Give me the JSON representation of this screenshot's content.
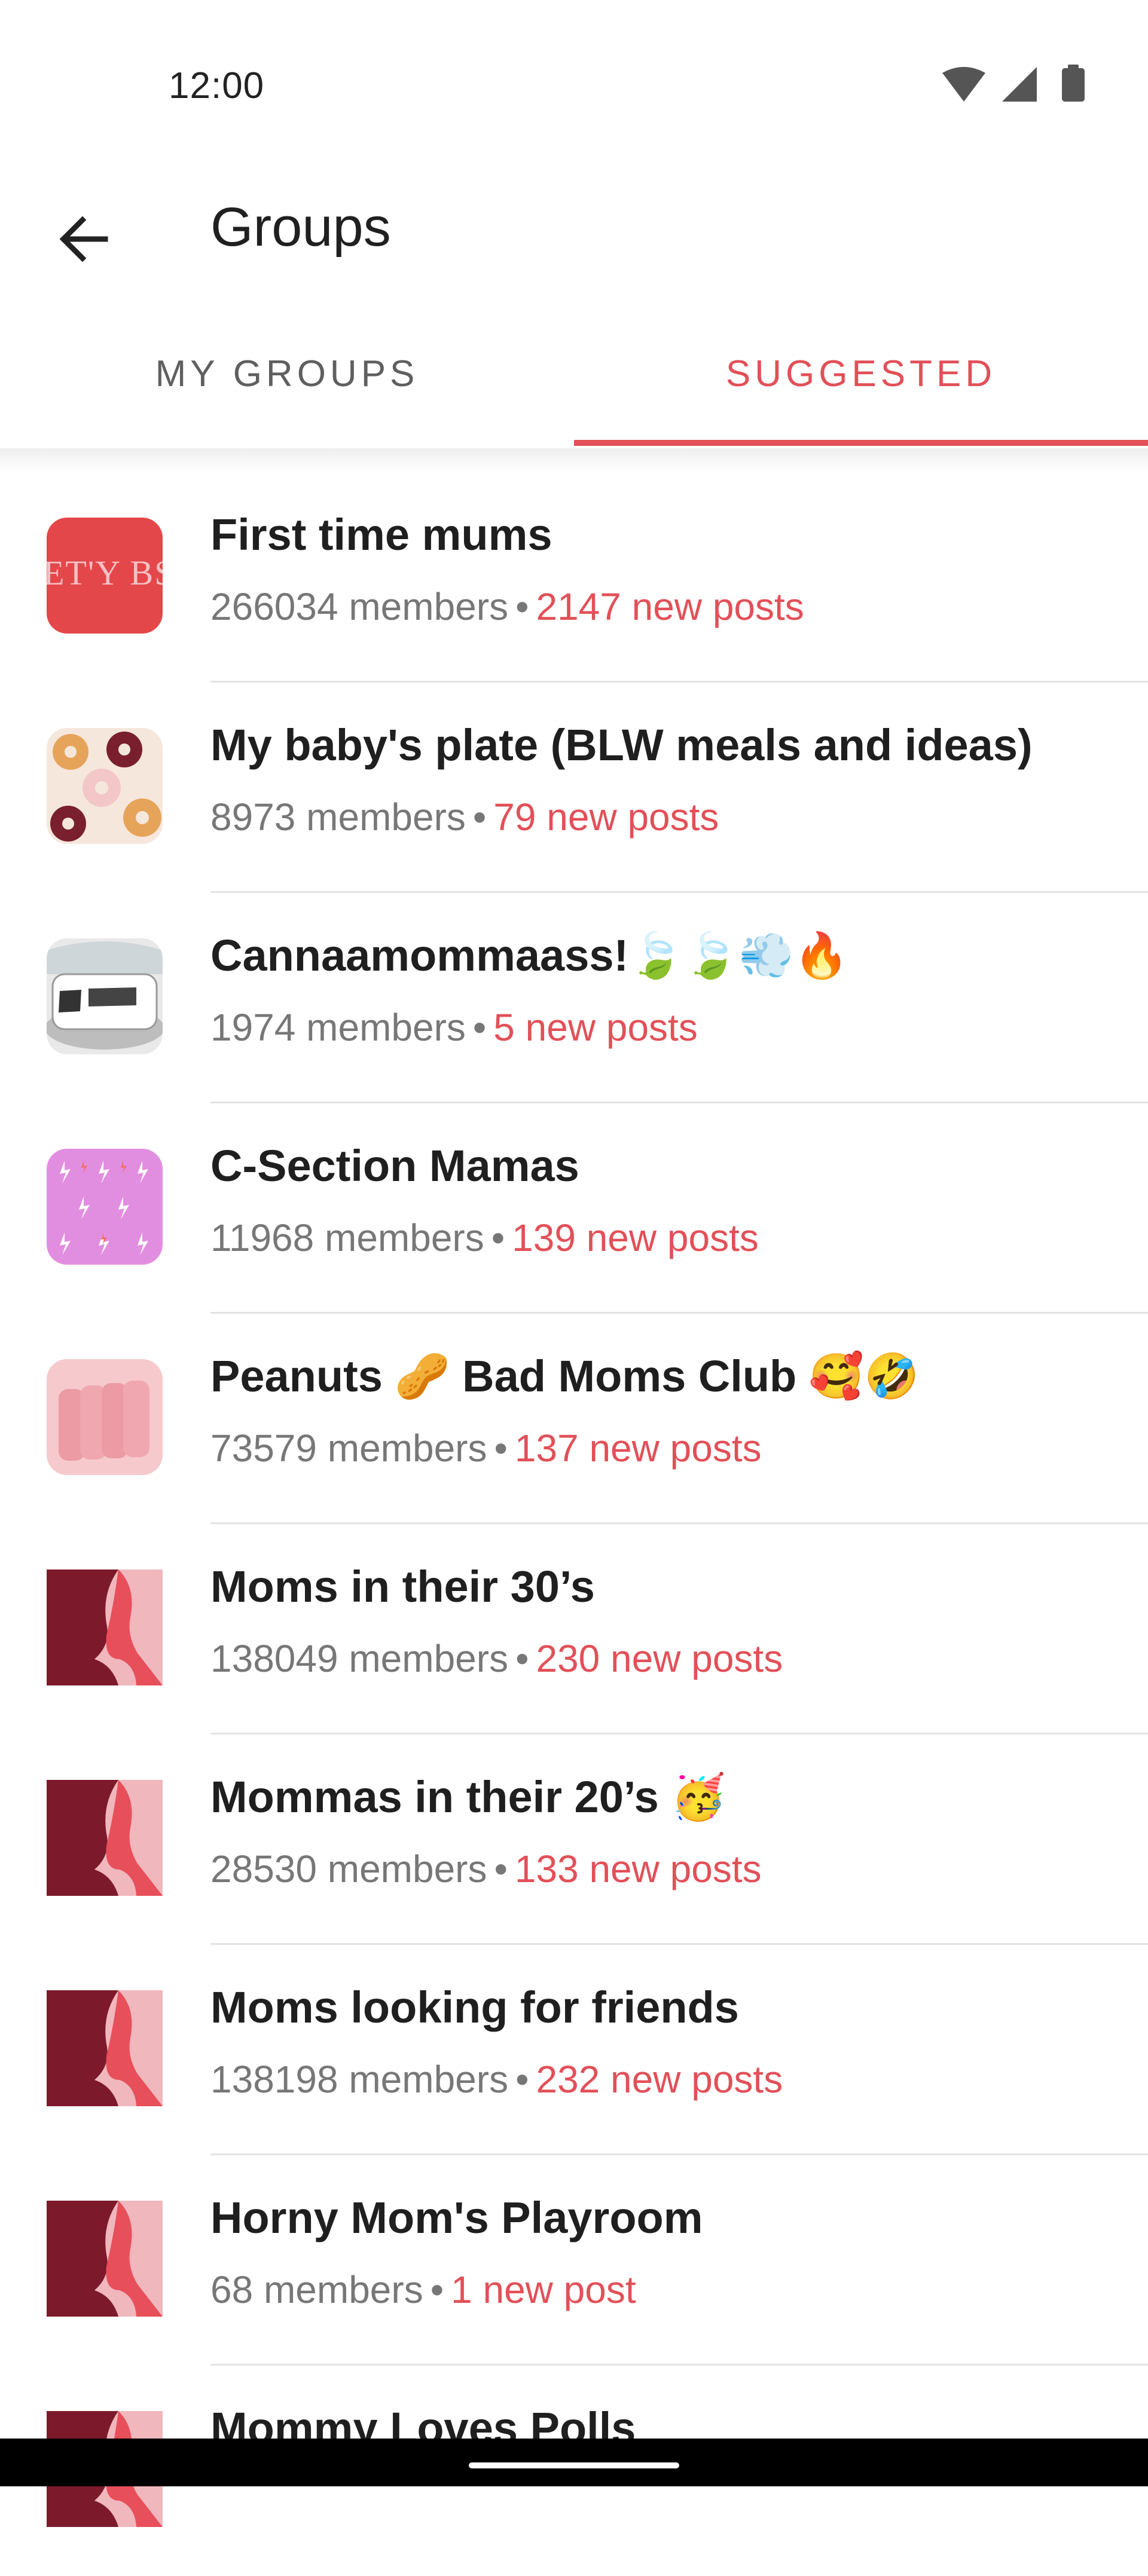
{
  "status_bar": {
    "time": "12:00",
    "icons": [
      "wifi-icon",
      "signal-icon",
      "battery-icon"
    ]
  },
  "app_bar": {
    "title": "Groups",
    "back_icon": "arrow-left-icon"
  },
  "tabs": [
    {
      "label": "MY GROUPS",
      "selected": false
    },
    {
      "label": "SUGGESTED",
      "selected": true
    }
  ],
  "colors": {
    "accent": "#e25058",
    "secondary_text": "#777777",
    "primary_text": "#1f1f1f"
  },
  "groups": [
    {
      "name": "First time mums",
      "members": "266034 members",
      "separator": "•",
      "new_posts": "2147 new posts",
      "thumb": "text-banner"
    },
    {
      "name": "My baby's plate (BLW meals and ideas)",
      "members": "8973 members",
      "separator": "•",
      "new_posts": "79 new posts",
      "thumb": "donuts"
    },
    {
      "name": "Cannaamommaass!🍃🍃💨🔥",
      "members": "1974 members",
      "separator": "•",
      "new_posts": "5 new posts",
      "thumb": "mug"
    },
    {
      "name": "C-Section Mamas",
      "members": "11968 members",
      "separator": "•",
      "new_posts": "139 new posts",
      "thumb": "lightning-pattern"
    },
    {
      "name": "Peanuts 🥜 Bad Moms Club 🥰🤣",
      "members": "73579 members",
      "separator": "•",
      "new_posts": "137 new posts",
      "thumb": "pink-stack"
    },
    {
      "name": "Moms in their 30’s",
      "members": "138049 members",
      "separator": "•",
      "new_posts": "230 new posts",
      "thumb": "silhouette"
    },
    {
      "name": "Mommas in their 20’s 🥳",
      "members": "28530 members",
      "separator": "•",
      "new_posts": "133 new posts",
      "thumb": "silhouette"
    },
    {
      "name": "Moms looking for friends",
      "members": "138198 members",
      "separator": "•",
      "new_posts": "232 new posts",
      "thumb": "silhouette"
    },
    {
      "name": "Horny Mom's Playroom",
      "members": "68 members",
      "separator": "•",
      "new_posts": "1 new post",
      "thumb": "silhouette"
    },
    {
      "name": "Mommy Loves Polls",
      "members": "",
      "separator": "",
      "new_posts": "",
      "thumb": "silhouette"
    }
  ]
}
